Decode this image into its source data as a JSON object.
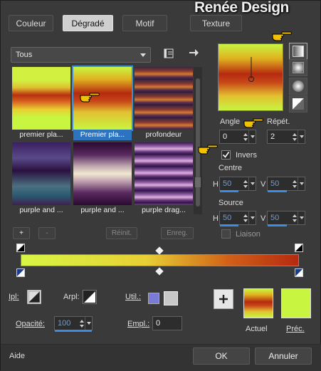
{
  "watermark": "Renée Design",
  "tabs": [
    {
      "label": "Couleur"
    },
    {
      "label": "Dégradé"
    },
    {
      "label": "Motif"
    },
    {
      "label": "Texture"
    }
  ],
  "filter": {
    "selected": "Tous"
  },
  "gradients": [
    {
      "label": "premier pla..."
    },
    {
      "label": "Premier pla..."
    },
    {
      "label": "profondeur"
    },
    {
      "label": "purple and ..."
    },
    {
      "label": "purple and ..."
    },
    {
      "label": "purple drag..."
    }
  ],
  "list_buttons": {
    "add": "+",
    "remove": "-",
    "reset": "Réinit.",
    "save": "Enreg."
  },
  "angle": {
    "label": "Angle",
    "value": "0"
  },
  "repeat": {
    "label": "Répét.",
    "value": "2"
  },
  "invert": {
    "label": "Invers",
    "checked": true
  },
  "center": {
    "label": "Centre",
    "h_label": "H",
    "h_value": "50",
    "v_label": "V",
    "v_value": "50"
  },
  "source": {
    "label": "Source",
    "h_label": "H",
    "h_value": "50",
    "v_label": "V",
    "v_value": "50"
  },
  "link": {
    "label": "Liaison"
  },
  "bottom": {
    "ipl_label": "Ipl:",
    "arpl_label": "Arpl:",
    "util_label": "Util.:",
    "opacity_label": "Opacité:",
    "opacity_value": "100",
    "empl_label": "Empl.:",
    "empl_value": "0",
    "actual_label": "Actuel",
    "prec_label": "Préc."
  },
  "footer": {
    "help": "Aide",
    "ok": "OK",
    "cancel": "Annuler"
  },
  "colors": {
    "accent": "#2d74c0",
    "lime": "#c8f53a",
    "red": "#b83010"
  }
}
